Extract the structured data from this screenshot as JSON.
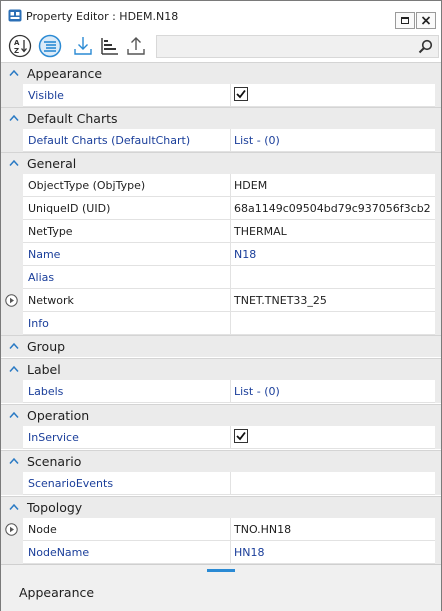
{
  "window": {
    "title": "Property Editor : HDEM.N18"
  },
  "toolbar": {
    "search_placeholder": ""
  },
  "categories": [
    {
      "label": "Appearance",
      "rows": [
        {
          "name": "Visible",
          "value": "",
          "checked": true
        }
      ]
    },
    {
      "label": "Default Charts",
      "rows": [
        {
          "name": "Default Charts (DefaultChart)",
          "value": "List - (0)"
        }
      ]
    },
    {
      "label": "General",
      "rows": [
        {
          "name": "ObjectType (ObjType)",
          "value": "HDEM"
        },
        {
          "name": "UniqueID (UID)",
          "value": "68a1149c09504bd79c937056f3cb2"
        },
        {
          "name": "NetType",
          "value": "THERMAL"
        },
        {
          "name": "Name",
          "value": "N18"
        },
        {
          "name": "Alias",
          "value": ""
        },
        {
          "name": "Network",
          "value": "TNET.TNET33_25"
        },
        {
          "name": "Info",
          "value": ""
        }
      ]
    },
    {
      "label": "Group"
    },
    {
      "label": "Label",
      "rows": [
        {
          "name": "Labels",
          "value": "List - (0)"
        }
      ]
    },
    {
      "label": "Operation",
      "rows": [
        {
          "name": "InService",
          "value": "",
          "checked": true
        }
      ]
    },
    {
      "label": "Scenario",
      "rows": [
        {
          "name": "ScenarioEvents",
          "value": ""
        }
      ]
    },
    {
      "label": "Topology",
      "rows": [
        {
          "name": "Node",
          "value": "TNO.HN18"
        },
        {
          "name": "NodeName",
          "value": "HN18"
        }
      ]
    }
  ],
  "description": {
    "title": "Appearance"
  }
}
